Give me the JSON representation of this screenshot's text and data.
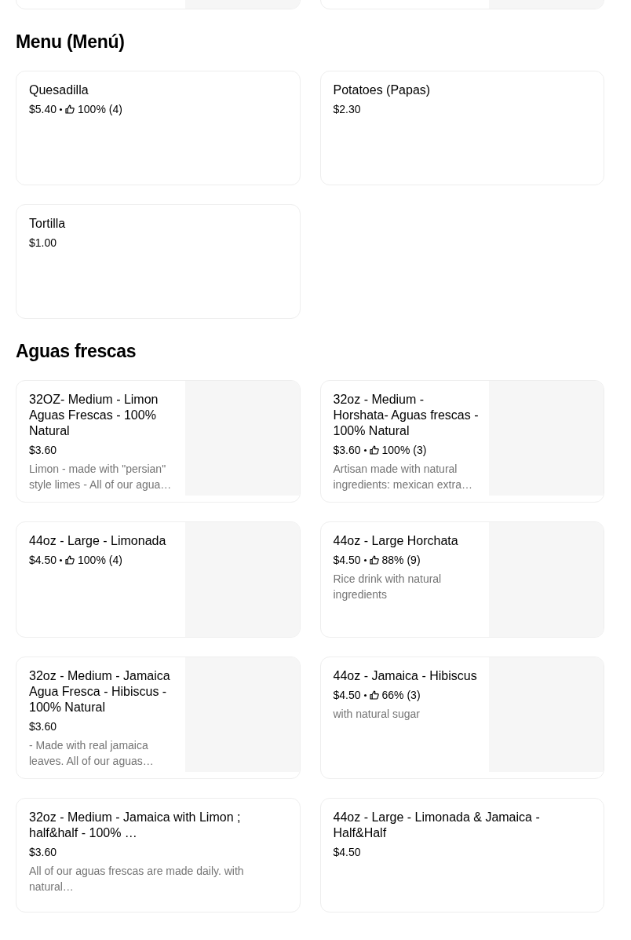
{
  "top_cards": [
    {
      "has_image": true
    },
    {
      "has_image": true
    }
  ],
  "sections": [
    {
      "title": "Menu (Menú)",
      "items": [
        {
          "name": "Quesadilla",
          "price": "$5.40",
          "rating": "100% (4)",
          "has_image": false
        },
        {
          "name": "Potatoes (Papas)",
          "price": "$2.30",
          "has_image": false
        },
        {
          "name": "Tortilla",
          "price": "$1.00",
          "has_image": false
        }
      ]
    },
    {
      "title": "Aguas frescas",
      "items": [
        {
          "name": "32OZ- Medium - Limon Aguas Frescas - 100% Natural",
          "price": "$3.60",
          "description": "Limon - made with \"persian\" style limes - All of our agua…",
          "has_image": true
        },
        {
          "name": "32oz - Medium - Horshata- Aguas frescas - 100% Natural",
          "price": "$3.60",
          "rating": "100% (3)",
          "description": "Artisan made with natural ingredients: mexican extra…",
          "has_image": true
        },
        {
          "name": "44oz - Large - Limonada",
          "price": "$4.50",
          "rating": "100% (4)",
          "has_image": true
        },
        {
          "name": "44oz - Large Horchata",
          "price": "$4.50",
          "rating": "88% (9)",
          "description": "Rice drink with natural ingredients",
          "has_image": true
        },
        {
          "name": "32oz - Medium - Jamaica Agua Fresca - Hibiscus - 100% Natural",
          "price": "$3.60",
          "description": "- Made with real jamaica leaves. All of our aguas…",
          "has_image": true
        },
        {
          "name": "44oz - Jamaica - Hibiscus",
          "price": "$4.50",
          "rating": "66% (3)",
          "description": "with natural sugar",
          "has_image": true
        },
        {
          "name": "32oz - Medium - Jamaica with Limon ; half&half - 100% …",
          "price": "$3.60",
          "description": "All of our aguas frescas are made daily. with natural…",
          "has_image": false
        },
        {
          "name": "44oz - Large - Limonada & Jamaica - Half&Half",
          "price": "$4.50",
          "has_image": false
        }
      ]
    }
  ]
}
